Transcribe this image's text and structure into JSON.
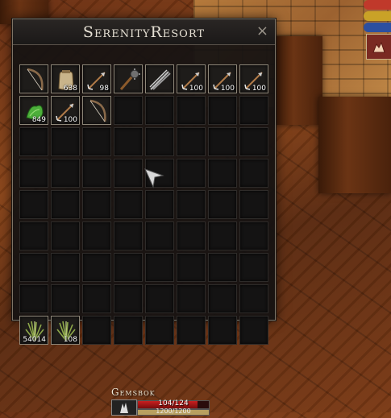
{
  "window": {
    "title": "SerenityResort",
    "close_glyph": "×"
  },
  "inventory": {
    "columns": 8,
    "rows": 9,
    "items": [
      {
        "slot": 0,
        "icon": "bow-icon",
        "quantity": ""
      },
      {
        "slot": 1,
        "icon": "leather-bag-icon",
        "quantity": "638"
      },
      {
        "slot": 2,
        "icon": "arrow-icon",
        "quantity": "98"
      },
      {
        "slot": 3,
        "icon": "mace-icon",
        "quantity": ""
      },
      {
        "slot": 4,
        "icon": "bolt-bundle-icon",
        "quantity": ""
      },
      {
        "slot": 5,
        "icon": "arrow-icon",
        "quantity": "100"
      },
      {
        "slot": 6,
        "icon": "arrow-icon",
        "quantity": "100"
      },
      {
        "slot": 7,
        "icon": "arrow-icon",
        "quantity": "100"
      },
      {
        "slot": 8,
        "icon": "green-herb-icon",
        "quantity": "849"
      },
      {
        "slot": 9,
        "icon": "arrow-icon",
        "quantity": "100"
      },
      {
        "slot": 10,
        "icon": "bow-icon",
        "quantity": ""
      },
      {
        "slot": 64,
        "icon": "fiber-bundle-icon",
        "quantity": "54014"
      },
      {
        "slot": 65,
        "icon": "fiber-bundle-icon",
        "quantity": "108"
      }
    ]
  },
  "target": {
    "name": "Gemsbok",
    "health_text": "104/124",
    "health_fraction": 0.84,
    "stamina_text": "1200/1200",
    "stamina_fraction": 1.0
  },
  "colors": {
    "frame_border": "#8d8678",
    "health": "#c82020",
    "status_red": "#c0392b",
    "status_yellow": "#c9a227",
    "status_blue": "#2c4fa0"
  }
}
